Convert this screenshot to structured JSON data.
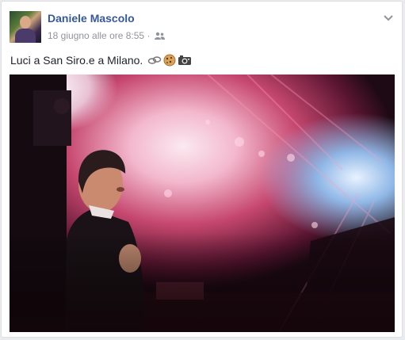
{
  "post": {
    "author": "Daniele Mascolo",
    "timestamp": "18 giugno alle ore 8:55",
    "separator": "·",
    "audience_icon": "friends-icon",
    "menu_icon": "chevron-down-icon",
    "text": "Luci a San Siro.e a Milano.",
    "emojis": [
      "chain-link-emoji",
      "cookie-emoji",
      "camera-emoji"
    ]
  },
  "colors": {
    "name": "#365899",
    "meta": "#90949c",
    "text": "#1d2129",
    "card_border": "#dddfe2",
    "page_bg": "#e9ebee"
  }
}
